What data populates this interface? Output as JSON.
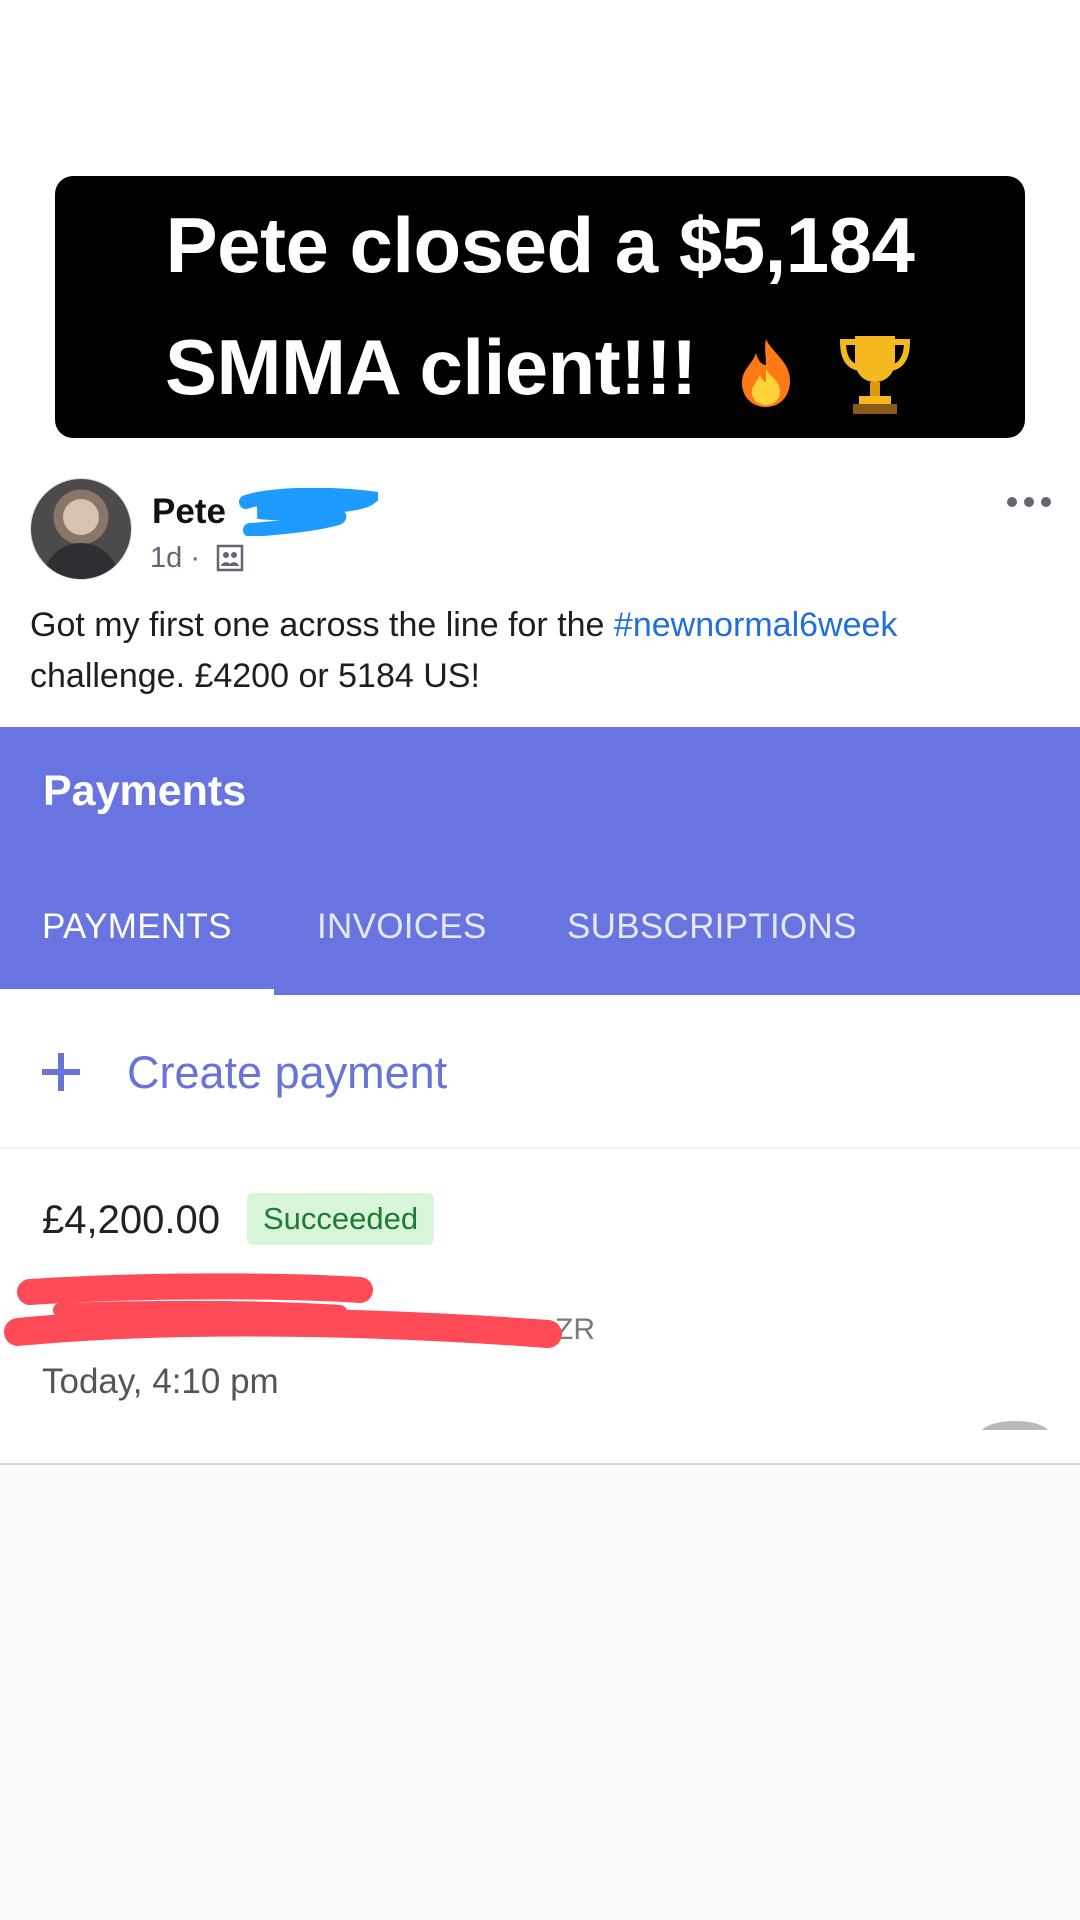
{
  "headline": {
    "line1": "Pete closed a $5,184",
    "line2": "SMMA client!!!",
    "emoji": [
      "fire-emoji",
      "trophy-emoji"
    ]
  },
  "post": {
    "author": "Pete",
    "time": "1d ·",
    "text_before": "Got my first one across the line for the ",
    "hashtag": "#newnormal6week",
    "text_after": " challenge. £4200 or 5184 US!"
  },
  "app": {
    "title": "Payments",
    "tabs": [
      "PAYMENTS",
      "INVOICES",
      "SUBSCRIPTIONS"
    ],
    "active_tab": "PAYMENTS",
    "create_label": "Create payment",
    "payment": {
      "amount": "£4,200.00",
      "status": "Succeeded",
      "id_visible_suffix": "ZR",
      "date": "Today, 4:10 pm"
    }
  },
  "colors": {
    "header_bg": "#6875e0",
    "accent": "#6674d8",
    "hashtag": "#216fdb",
    "badge_bg": "#d8f4d9",
    "badge_text": "#1f7a34",
    "redact_blue": "#1e9bff",
    "redact_red": "#ff4a57"
  }
}
